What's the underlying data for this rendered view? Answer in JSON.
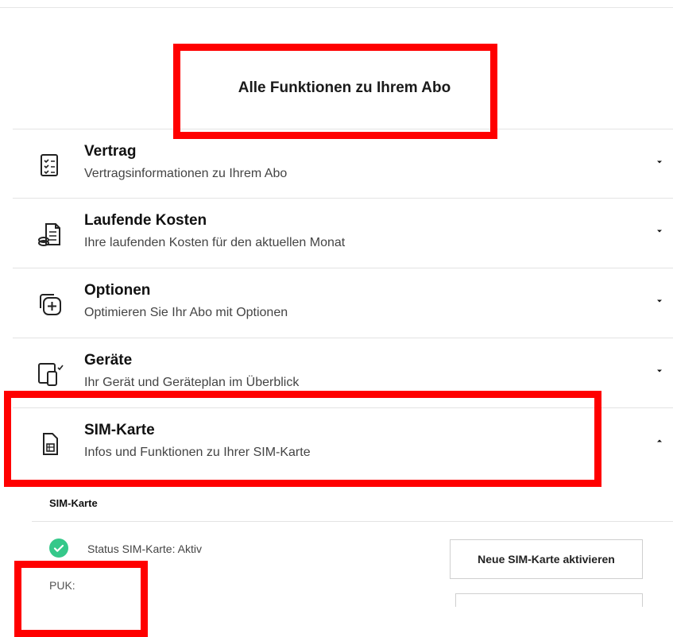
{
  "page_title": "Alle Funktionen zu Ihrem Abo",
  "accordion": [
    {
      "title": "Vertrag",
      "subtitle": "Vertragsinformationen zu Ihrem Abo",
      "icon": "contract-checklist-icon",
      "expanded": false
    },
    {
      "title": "Laufende Kosten",
      "subtitle": "Ihre laufenden Kosten für den aktuellen Monat",
      "icon": "invoice-coins-icon",
      "expanded": false
    },
    {
      "title": "Optionen",
      "subtitle": "Optimieren Sie Ihr Abo mit Optionen",
      "icon": "add-option-icon",
      "expanded": false
    },
    {
      "title": "Geräte",
      "subtitle": "Ihr Gerät und Geräteplan im Überblick",
      "icon": "devices-icon",
      "expanded": false
    },
    {
      "title": "SIM-Karte",
      "subtitle": "Infos und Funktionen zu Ihrer SIM-Karte",
      "icon": "sim-card-icon",
      "expanded": true
    }
  ],
  "sim_section": {
    "heading": "SIM-Karte",
    "status_text": "Status SIM-Karte: Aktiv",
    "puk_label": "PUK:",
    "activate_button": "Neue SIM-Karte aktivieren"
  },
  "colors": {
    "highlight": "#ff0000",
    "status_ok": "#35c88a",
    "divider": "#e3e3e3"
  }
}
